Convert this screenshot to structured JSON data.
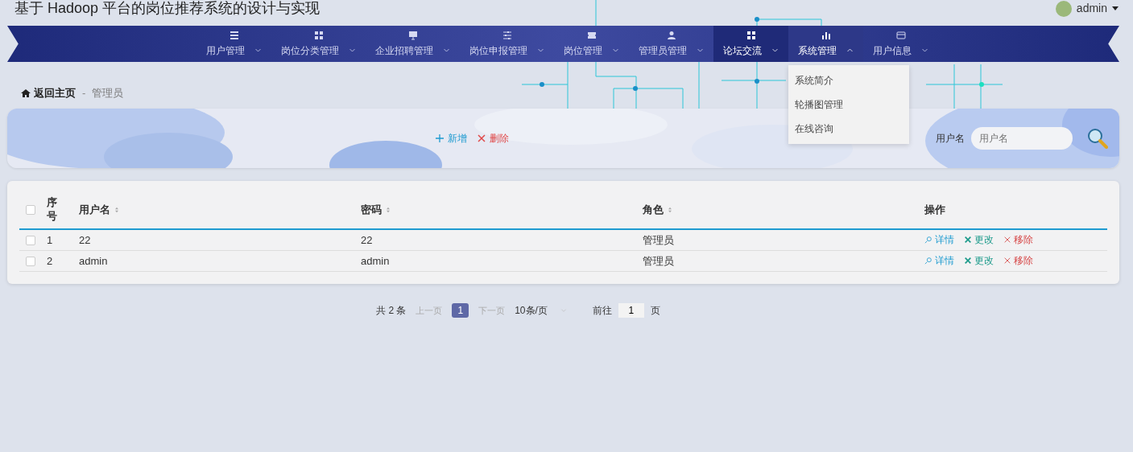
{
  "header": {
    "title": "基于 Hadoop 平台的岗位推荐系统的设计与实现",
    "user": "admin"
  },
  "nav": [
    {
      "label": "用户管理",
      "selected": false,
      "expanded": false
    },
    {
      "label": "岗位分类管理",
      "selected": false,
      "expanded": false
    },
    {
      "label": "企业招聘管理",
      "selected": false,
      "expanded": false
    },
    {
      "label": "岗位申报管理",
      "selected": false,
      "expanded": false
    },
    {
      "label": "岗位管理",
      "selected": false,
      "expanded": false
    },
    {
      "label": "管理员管理",
      "selected": false,
      "expanded": false
    },
    {
      "label": "论坛交流",
      "selected": true,
      "expanded": false
    },
    {
      "label": "系统管理",
      "selected": false,
      "expanded": true,
      "submenu": [
        "系统简介",
        "轮播图管理",
        "在线咨询"
      ]
    },
    {
      "label": "用户信息",
      "selected": false,
      "expanded": false
    }
  ],
  "breadcrumb": {
    "home": "返回主页",
    "separator": "-",
    "current": "管理员"
  },
  "toolbar": {
    "add": "新增",
    "delete": "删除",
    "search_label": "用户名",
    "search_placeholder": "用户名"
  },
  "table": {
    "select_all": {
      "checked": false
    },
    "columns": [
      {
        "label": "序号",
        "sortable": false
      },
      {
        "label": "用户名",
        "sortable": true
      },
      {
        "label": "密码",
        "sortable": true
      },
      {
        "label": "角色",
        "sortable": true
      },
      {
        "label": "操作",
        "sortable": false
      }
    ],
    "rows": [
      {
        "checked": false,
        "cells": [
          "1",
          "22",
          "22",
          "管理员"
        ],
        "actions": [
          "详情",
          "更改",
          "移除"
        ]
      },
      {
        "checked": false,
        "cells": [
          "2",
          "admin",
          "admin",
          "管理员"
        ],
        "actions": [
          "详情",
          "更改",
          "移除"
        ]
      }
    ]
  },
  "pagination": {
    "total": "共 2 条",
    "prev": {
      "label": "上一页",
      "disabled": true
    },
    "pages": [
      {
        "label": "1",
        "selected": true
      }
    ],
    "next": {
      "label": "下一页",
      "disabled": true
    },
    "page_size": "10条/页",
    "goto_label": "前往",
    "goto_value": "1",
    "goto_suffix": "页"
  }
}
